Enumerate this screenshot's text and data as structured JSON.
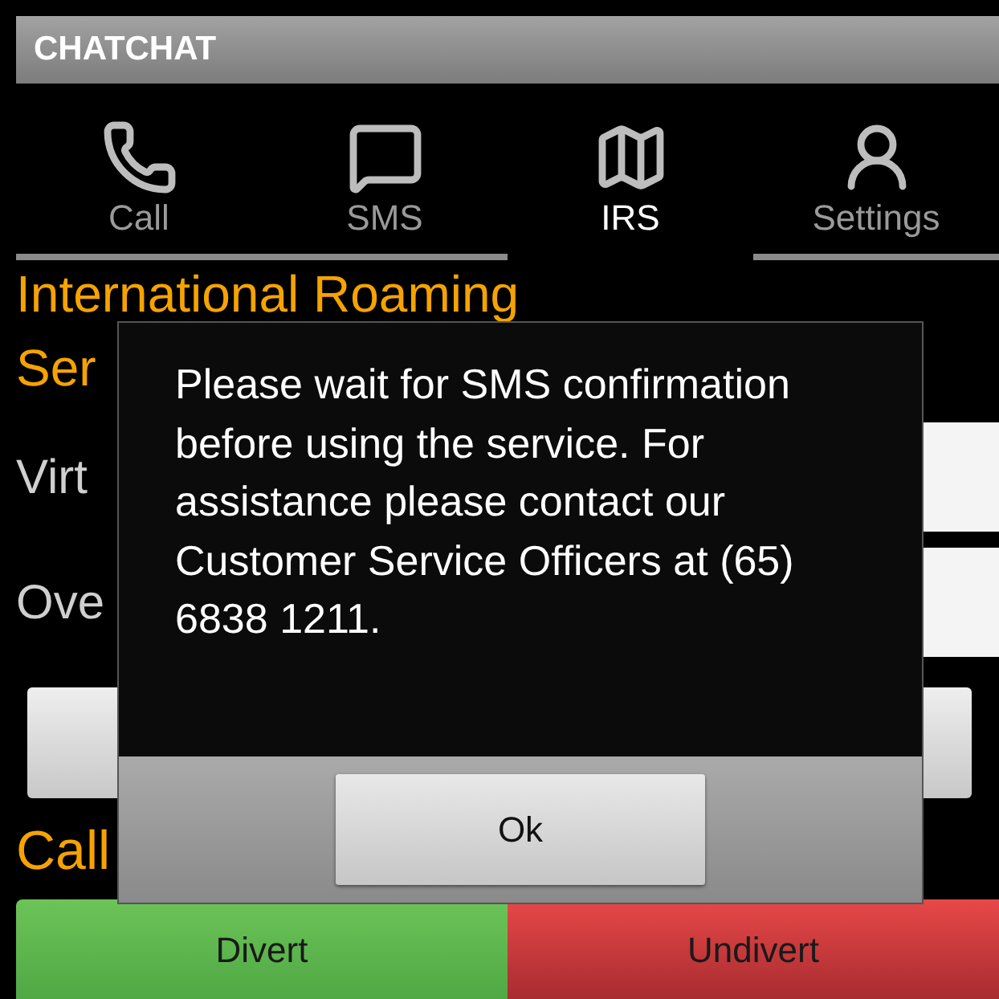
{
  "app_bar": {
    "title": "CHATCHAT"
  },
  "tabs": [
    {
      "label": "Call",
      "kind": "phone",
      "selected": false
    },
    {
      "label": "SMS",
      "kind": "message",
      "selected": false
    },
    {
      "label": "IRS",
      "kind": "map",
      "selected": true
    },
    {
      "label": "Settings",
      "kind": "profile",
      "selected": false
    }
  ],
  "screen": {
    "heading_lines": [
      "International Roaming",
      "Ser"
    ],
    "rows": [
      {
        "label": "Virt"
      },
      {
        "label": "Ove"
      }
    ],
    "section_label": "Call"
  },
  "actions": [
    {
      "label": "Divert",
      "kind": "positive"
    },
    {
      "label": "Undivert",
      "kind": "negative"
    }
  ],
  "dialog": {
    "message": "Please wait for SMS confirmation before using the service. For assistance please contact our Customer Service Officers at (65) 6838 1211.",
    "button": "Ok"
  }
}
